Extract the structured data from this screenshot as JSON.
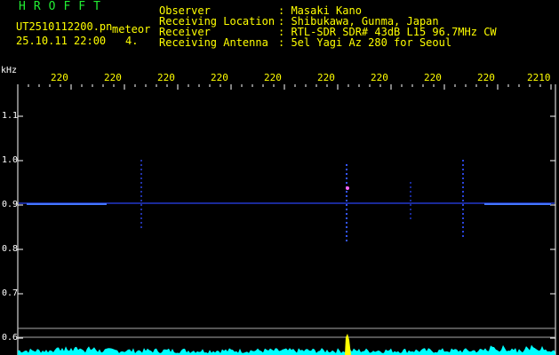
{
  "header": {
    "logo_letters": "HROFFT",
    "filename": "UT2510112200.pn",
    "meteor_label": "meteor",
    "datetime": "25.10.11 22:00",
    "count": "4."
  },
  "info": [
    {
      "label": "Observer",
      "value": ": Masaki Kano"
    },
    {
      "label": "Receiving Location",
      "value": ": Shibukawa, Gunma, Japan"
    },
    {
      "label": "Receiver",
      "value": ": RTL-SDR SDR# 43dB L15 96.7MHz CW"
    },
    {
      "label": "Receiving Antenna",
      "value": ": 5el Yagi Az 280 for Seoul"
    }
  ],
  "axes": {
    "y_unit": "kHz",
    "y_ticks": [
      "1.1",
      "1.0",
      "0.9",
      "0.8",
      "0.7",
      "0.6"
    ],
    "x_ticks": [
      "220",
      "220",
      "220",
      "220",
      "220",
      "220",
      "220",
      "220",
      "220",
      "2210"
    ]
  },
  "colors": {
    "background": "#000000",
    "text_yellow": "#ffff00",
    "logo_green": "#22ee33",
    "signal_blue": "#3355ff",
    "spectrum_cyan": "#00ffff",
    "meteor_yellow": "#ffff00"
  }
}
